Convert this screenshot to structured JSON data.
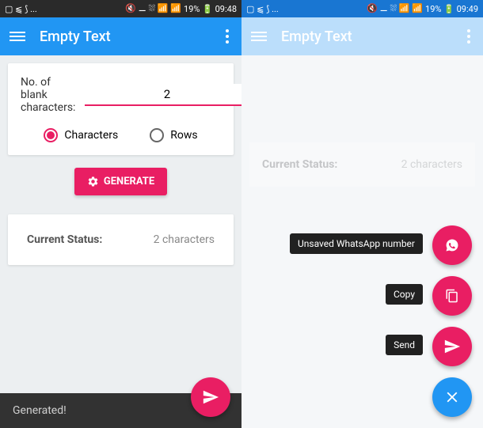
{
  "status_bar": {
    "left_icons": "▢ ⫹ ⟆ ...",
    "right_icons": "🔇 ⚊ ⛆ 📶 📶",
    "battery_left": "19% 🔋 09:48",
    "battery_right": "19% 🔋 09:49"
  },
  "app": {
    "title": "Empty Text"
  },
  "input": {
    "label": "No. of blank characters:",
    "value": "2"
  },
  "radios": {
    "characters": "Characters",
    "rows": "Rows"
  },
  "generate": {
    "label": "GENERATE"
  },
  "status": {
    "label": "Current Status:",
    "value": "2 characters"
  },
  "snackbar": {
    "text": "Generated!"
  },
  "fab_labels": {
    "whatsapp": "Unsaved WhatsApp number",
    "copy": "Copy",
    "send": "Send"
  }
}
